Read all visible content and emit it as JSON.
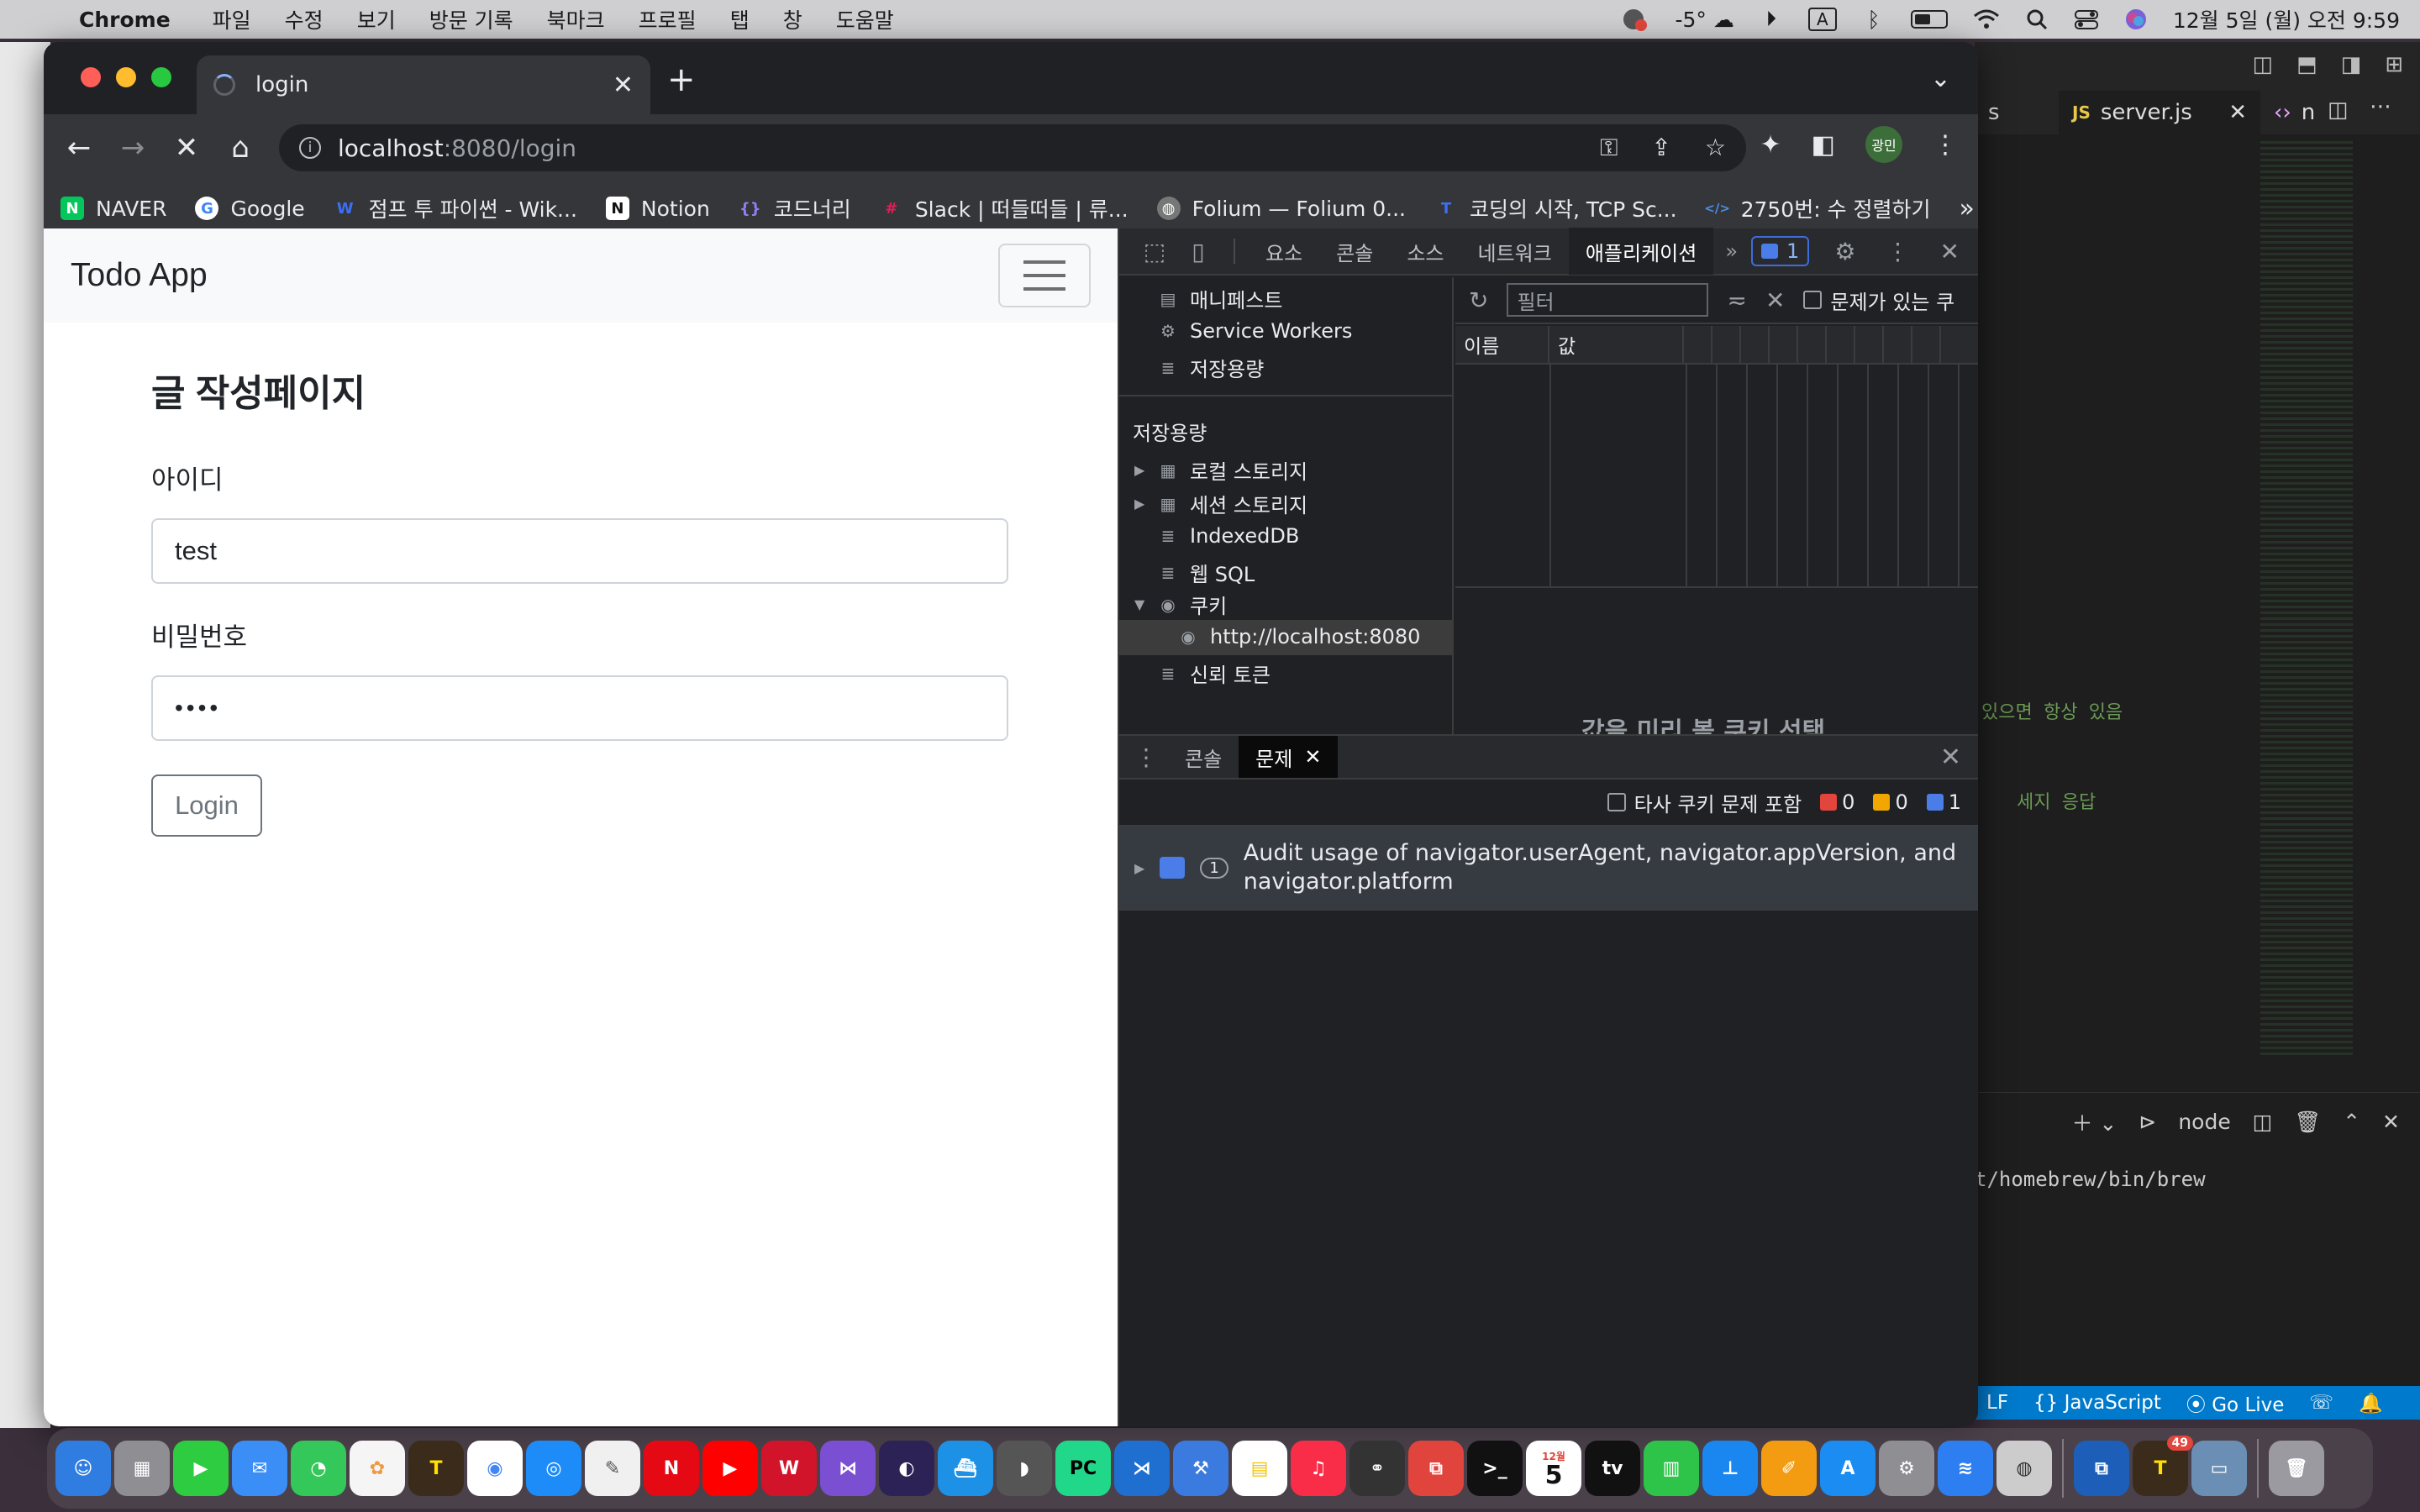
{
  "menubar": {
    "app": "Chrome",
    "items": [
      "파일",
      "수정",
      "보기",
      "방문 기록",
      "북마크",
      "프로필",
      "탭",
      "창",
      "도움말"
    ],
    "weather": "-5°",
    "input_mode": "A",
    "datetime": "12월 5일 (월) 오전 9:59"
  },
  "chrome": {
    "tab_title": "login",
    "url_host": "localhost",
    "url_path": ":8080/login",
    "profile_label": "광민",
    "bookmarks": [
      {
        "label": "NAVER",
        "icon": "N",
        "color": "#03c75a"
      },
      {
        "label": "Google",
        "icon": "G",
        "color": "#4285f4"
      },
      {
        "label": "점프 투 파이썬 - Wik...",
        "icon": "W",
        "color": "#3d6ef5"
      },
      {
        "label": "Notion",
        "icon": "N",
        "color": "#111111"
      },
      {
        "label": "코드너리",
        "icon": "{}",
        "color": "#6b5bd6"
      },
      {
        "label": "Slack | 떠들떠들 | 류...",
        "icon": "#",
        "color": "#e01e5a"
      },
      {
        "label": "Folium — Folium 0...",
        "icon": "F",
        "color": "#777777"
      },
      {
        "label": "코딩의 시작, TCP Sc...",
        "icon": "T",
        "color": "#3d6ef5"
      },
      {
        "label": "2750번: 수 정렬하기",
        "icon": "</>",
        "color": "#4a90e2"
      }
    ]
  },
  "page": {
    "brand": "Todo App",
    "heading": "글 작성페이지",
    "id_label": "아이디",
    "id_value": "test",
    "pw_label": "비밀번호",
    "pw_value": "••••",
    "login_button": "Login"
  },
  "devtools": {
    "tabs": [
      "요소",
      "콘솔",
      "소스",
      "네트워크",
      "애플리케이션"
    ],
    "active_tab": "애플리케이션",
    "issue_count": "1",
    "app_items": [
      "매니페스트",
      "Service Workers",
      "저장용량"
    ],
    "storage_header": "저장용량",
    "storage_items": [
      "로컬 스토리지",
      "세션 스토리지",
      "IndexedDB",
      "웹 SQL",
      "쿠키"
    ],
    "cookie_origin": "http://localhost:8080",
    "trust_tokens": "신뢰 토큰",
    "filter_placeholder": "필터",
    "filter_issue_check": "문제가 있는 쿠",
    "col_name": "이름",
    "col_value": "값",
    "empty_hint": "값을 미리 볼 쿠키 선택",
    "drawer_tabs": [
      "콘솔",
      "문제"
    ],
    "third_party_check": "타사 쿠키 문제 포함",
    "counts": {
      "errors": "0",
      "warnings": "0",
      "infos": "1"
    },
    "issue_count_pill": "1",
    "issue_text_1": "Audit usage of navigator.userAgent, navigator.appVersion, and",
    "issue_text_2": "navigator.platform"
  },
  "vscode": {
    "tab_prev": "s",
    "tab_active": "server.js",
    "tab_next": "n",
    "comment_1": "있으면 항상 있음",
    "comment_2": "세지 응답",
    "terminal_label": "node",
    "terminal_line": "t/homebrew/bin/brew",
    "status_lf": "LF",
    "status_lang": "{} JavaScript",
    "status_golive": "Go Live"
  },
  "dock": {
    "calendar_month": "12월",
    "calendar_day": "5",
    "kakao_badge": "49"
  }
}
